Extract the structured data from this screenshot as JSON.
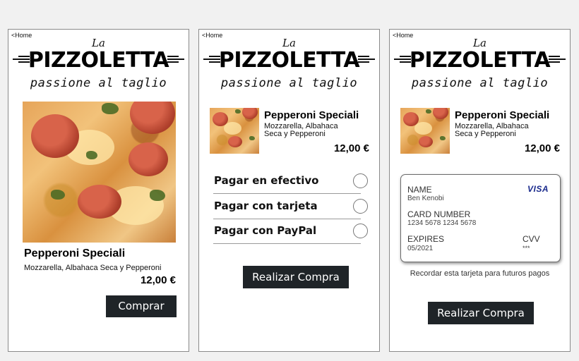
{
  "common": {
    "home_link": "<Home",
    "logo_la": "La",
    "logo_brand": "PIZZOLETTA",
    "logo_tagline": "passione al taglio"
  },
  "product": {
    "name": "Pepperoni Speciali",
    "description": "Mozzarella, Albahaca Seca y Pepperoni",
    "description_line1": "Mozzarella, Albahaca",
    "description_line2": "Seca y Pepperoni",
    "price": "12,00 €"
  },
  "screen1": {
    "buy_button": "Comprar"
  },
  "screen2": {
    "options": [
      {
        "label": "Pagar en efectivo",
        "selected": false
      },
      {
        "label": "Pagar con tarjeta",
        "selected": false
      },
      {
        "label": "Pagar con PayPal",
        "selected": false
      }
    ],
    "submit_button": "Realizar Compra"
  },
  "screen3": {
    "card": {
      "brand": "VISA",
      "name_label": "NAME",
      "name_value": "Ben Kenobi",
      "number_label": "CARD NUMBER",
      "number_value": "1234 5678 1234 5678",
      "expires_label": "EXPIRES",
      "expires_value": "05/2021",
      "cvv_label": "CVV",
      "cvv_value": "***"
    },
    "remember_text": "Recordar esta tarjeta para futuros pagos",
    "submit_button": "Realizar Compra"
  },
  "colors": {
    "button_bg": "#1f2428",
    "visa_blue": "#1a2a8c"
  }
}
